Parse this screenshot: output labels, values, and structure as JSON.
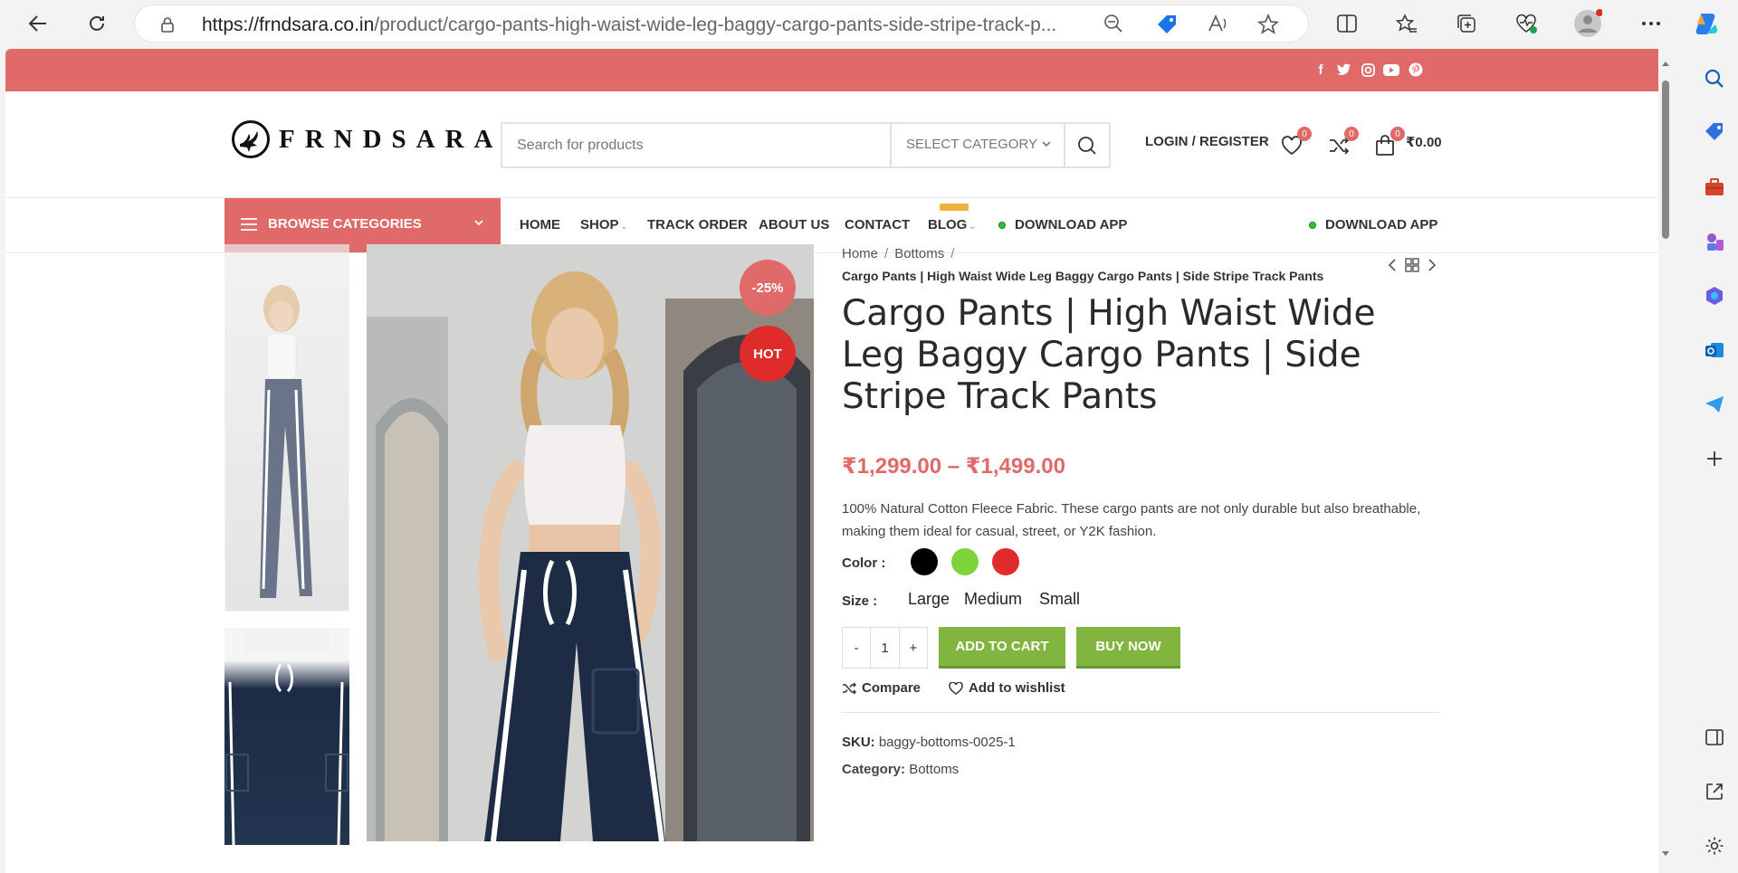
{
  "browser": {
    "url_host": "https://frndsara.co.in",
    "url_path": "/product/cargo-pants-high-waist-wide-leg-baggy-cargo-pants-side-stripe-track-p..."
  },
  "site": {
    "logo_text": "FRNDSARA",
    "search_placeholder": "Search for products",
    "category_select": "SELECT CATEGORY",
    "login_label": "LOGIN / REGISTER",
    "wishlist_count": "0",
    "compare_count": "0",
    "cart_count": "0",
    "cart_total": "₹0.00"
  },
  "nav": {
    "browse_label": "BROWSE CATEGORIES",
    "items": [
      "HOME",
      "SHOP",
      "TRACK ORDER",
      "ABOUT US",
      "CONTACT",
      "BLOG",
      "DOWNLOAD APP"
    ],
    "right_link": "DOWNLOAD APP"
  },
  "product": {
    "badge_sale": "-25%",
    "badge_hot": "HOT",
    "breadcrumb_home": "Home",
    "breadcrumb_cat": "Bottoms",
    "breadcrumb_current": "Cargo Pants | High Waist Wide Leg Baggy Cargo Pants | Side Stripe Track Pants",
    "title": "Cargo Pants | High Waist Wide Leg Baggy Cargo Pants | Side Stripe Track Pants",
    "price": "₹1,299.00 – ₹1,499.00",
    "description": "100% Natural Cotton Fleece Fabric. These cargo pants are not only durable but also breathable, making them ideal for casual, street, or Y2K fashion.",
    "color_label": "Color :",
    "colors": [
      "#000000",
      "#7ed23a",
      "#e02b2b"
    ],
    "size_label": "Size :",
    "sizes": [
      "Large",
      "Medium",
      "Small"
    ],
    "qty_minus": "-",
    "qty_value": "1",
    "qty_plus": "+",
    "add_to_cart": "ADD TO CART",
    "buy_now": "BUY NOW",
    "compare": "Compare",
    "wishlist": "Add to wishlist",
    "sku_label": "SKU:",
    "sku": "baggy-bottoms-0025-1",
    "category_label": "Category:",
    "category": "Bottoms"
  }
}
